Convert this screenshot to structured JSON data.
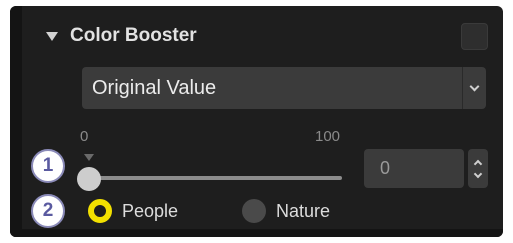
{
  "section": {
    "title": "Color Booster",
    "enabled": false
  },
  "dropdown": {
    "value": "Original Value",
    "icon": "chevron-down-icon"
  },
  "slider": {
    "min_label": "0",
    "max_label": "100",
    "value": 0
  },
  "value_input": {
    "value": "0"
  },
  "radio": {
    "options": [
      {
        "label": "People",
        "selected": true
      },
      {
        "label": "Nature",
        "selected": false
      }
    ]
  },
  "callouts": [
    "1",
    "2"
  ],
  "colors": {
    "panel_bg": "#1e1e1e",
    "control_bg": "#3b3b3b",
    "accent_yellow": "#f2e000",
    "callout_border": "#8a8ab8"
  }
}
